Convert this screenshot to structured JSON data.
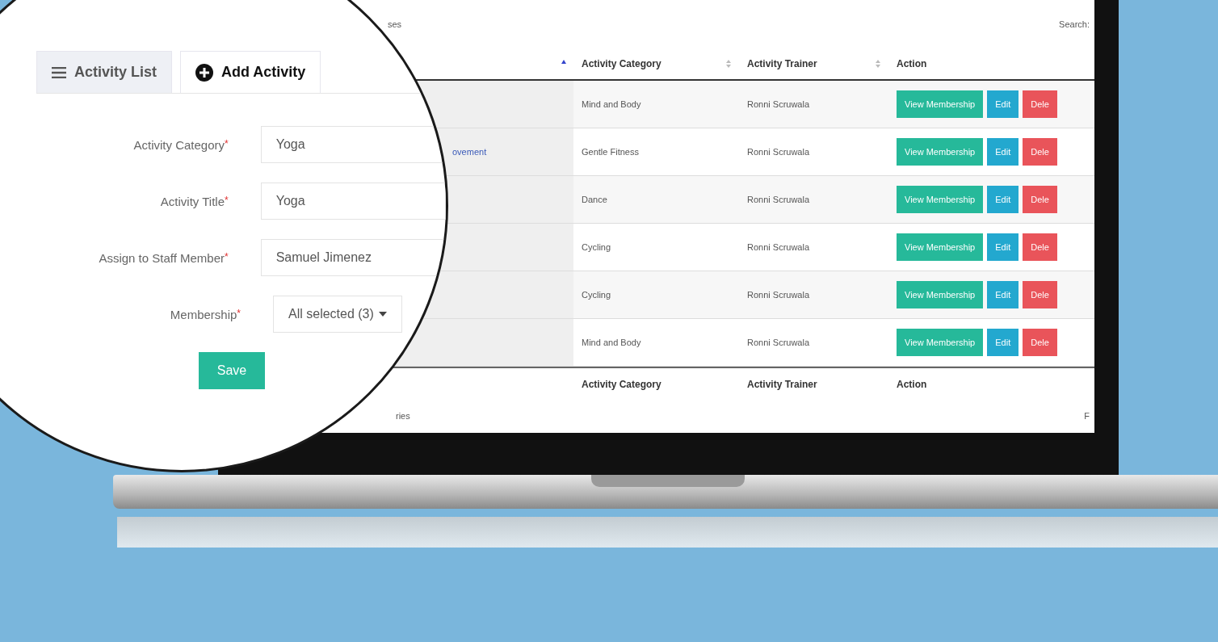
{
  "screen": {
    "heading_fragment": "ses",
    "search_label": "Search:",
    "table": {
      "column_1_sorted": true,
      "columns": [
        {
          "label": "Activity Category",
          "sorted": false
        },
        {
          "label": "Activity Trainer",
          "sorted": false
        },
        {
          "label": "Action"
        }
      ],
      "rows": [
        {
          "category": "Mind and Body",
          "trainer": "Ronni Scruwala",
          "actions": [
            "View Membership",
            "Edit",
            "Dele"
          ]
        },
        {
          "column_1": "ovement",
          "category": "Gentle Fitness",
          "trainer": "Ronni Scruwala",
          "actions": [
            "View Membership",
            "Edit",
            "Dele"
          ]
        },
        {
          "category": "Dance",
          "trainer": "Ronni Scruwala",
          "actions": [
            "View Membership",
            "Edit",
            "Dele"
          ]
        },
        {
          "category": "Cycling",
          "trainer": "Ronni Scruwala",
          "actions": [
            "View Membership",
            "Edit",
            "Dele"
          ]
        },
        {
          "category": "Cycling",
          "trainer": "Ronni Scruwala",
          "actions": [
            "View Membership",
            "Edit",
            "Dele"
          ]
        },
        {
          "category": "Mind and Body",
          "trainer": "Ronni Scruwala",
          "actions": [
            "View Membership",
            "Edit",
            "Dele"
          ]
        }
      ],
      "footer_columns": [
        "Activity Category",
        "Activity Trainer",
        "Action"
      ],
      "info_fragment": "ries",
      "pagination_fragment": "F"
    }
  },
  "magnifier": {
    "tabs": [
      {
        "label": "Activity List",
        "selected": false
      },
      {
        "label": "Add Activity",
        "selected": true
      }
    ],
    "fields": [
      {
        "label": "Activity Category",
        "required_mark": "*",
        "kind": "input",
        "value": "Yoga"
      },
      {
        "label": "Activity Title",
        "required_mark": "*",
        "kind": "input",
        "value": "Yoga"
      },
      {
        "label": "Assign to Staff Member",
        "required_mark": "*",
        "kind": "input",
        "value": "Samuel Jimenez"
      },
      {
        "label": "Membership",
        "required_mark": "*",
        "kind": "dropdown",
        "value": "All selected (3)"
      }
    ],
    "save_button": "Save"
  }
}
